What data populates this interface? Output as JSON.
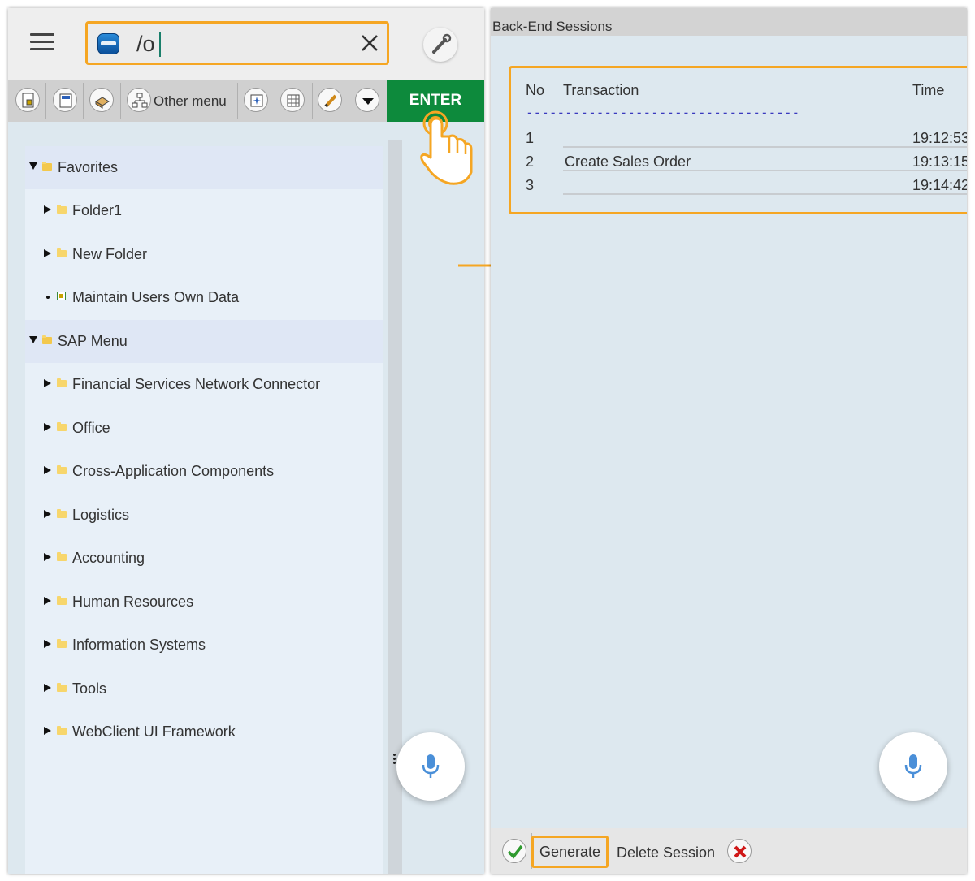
{
  "left_screen": {
    "command_field": {
      "value": "/o"
    },
    "toolbar": {
      "other_menu_label": "Other menu",
      "enter_label": "ENTER"
    },
    "tree": [
      {
        "label": "Favorites",
        "level": 0,
        "type": "folder-open",
        "expanded": true
      },
      {
        "label": "Folder1",
        "level": 1,
        "type": "folder",
        "expanded": false
      },
      {
        "label": "New Folder",
        "level": 1,
        "type": "folder",
        "expanded": false
      },
      {
        "label": "Maintain Users Own Data",
        "level": 1,
        "type": "transaction"
      },
      {
        "label": "SAP Menu",
        "level": 0,
        "type": "folder-open",
        "expanded": true
      },
      {
        "label": "Financial Services Network Connector",
        "level": 1,
        "type": "folder",
        "expanded": false
      },
      {
        "label": "Office",
        "level": 1,
        "type": "folder",
        "expanded": false
      },
      {
        "label": "Cross-Application Components",
        "level": 1,
        "type": "folder",
        "expanded": false
      },
      {
        "label": "Logistics",
        "level": 1,
        "type": "folder",
        "expanded": false
      },
      {
        "label": "Accounting",
        "level": 1,
        "type": "folder",
        "expanded": false
      },
      {
        "label": "Human Resources",
        "level": 1,
        "type": "folder",
        "expanded": false
      },
      {
        "label": "Information Systems",
        "level": 1,
        "type": "folder",
        "expanded": false
      },
      {
        "label": "Tools",
        "level": 1,
        "type": "folder",
        "expanded": false
      },
      {
        "label": "WebClient UI Framework",
        "level": 1,
        "type": "folder",
        "expanded": false
      }
    ]
  },
  "right_screen": {
    "title": "Back-End Sessions",
    "columns": {
      "no": "No",
      "transaction": "Transaction",
      "time": "Time"
    },
    "separator": "--------------------------------------------------",
    "sessions": [
      {
        "no": "1",
        "transaction": "",
        "time": "19:12:53"
      },
      {
        "no": "2",
        "transaction": "Create Sales Order",
        "time": "19:13:15"
      },
      {
        "no": "3",
        "transaction": "",
        "time": "19:14:42"
      }
    ],
    "footer": {
      "generate_label": "Generate",
      "delete_label": "Delete Session"
    }
  },
  "colors": {
    "highlight": "#f5a623",
    "enter_green": "#0d8a3c",
    "panel_bg": "#dde8ef"
  }
}
